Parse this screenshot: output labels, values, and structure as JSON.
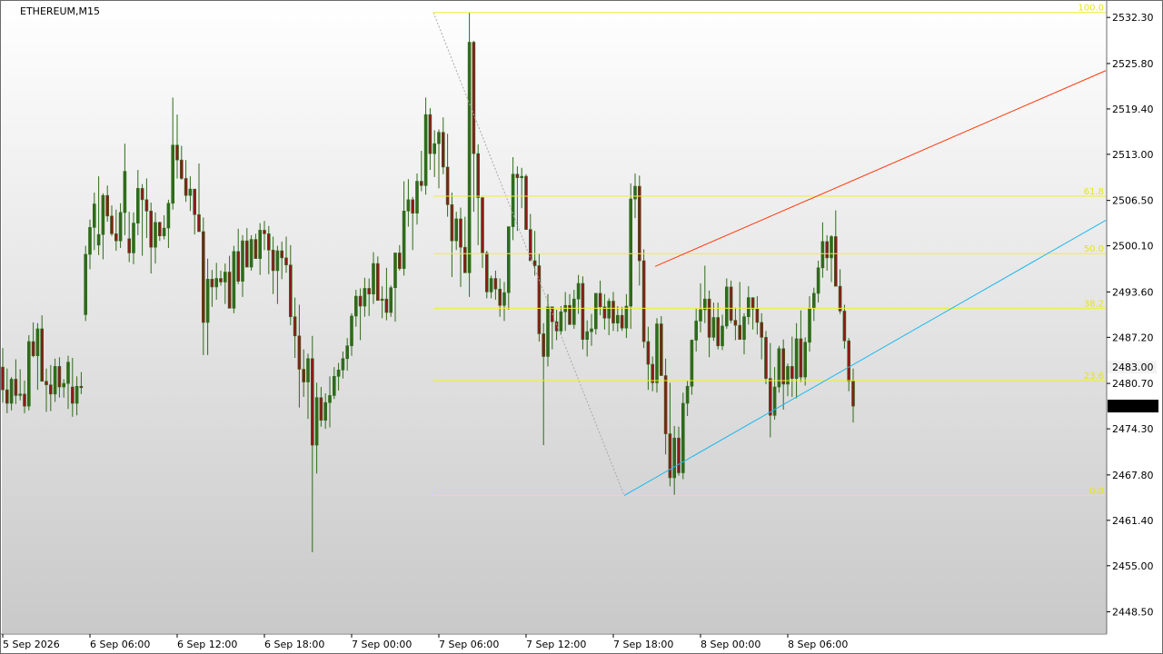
{
  "symbol_label": "ETHEREUM,M15",
  "colors": {
    "bull_candle": "#2f6b1a",
    "bear_candle": "#8b1a1a",
    "wick": "#2f6b1a",
    "fib_line": "#f2ee30",
    "fib_text": "#e9e21c",
    "upper_channel": "#ff3b10",
    "lower_channel": "#1cb8ee",
    "current_price_bg": "#000000",
    "ghost_price": "#bdbdbd"
  },
  "chart_data": {
    "type": "candlestick",
    "title": "ETHEREUM,M15",
    "y_axis": {
      "min": 2445.5,
      "max": 2534.5,
      "ticks": [
        2532.3,
        2525.8,
        2519.4,
        2513.0,
        2506.5,
        2500.1,
        2493.6,
        2487.2,
        2480.7,
        2474.3,
        2467.8,
        2461.4,
        2455.0,
        2448.5
      ],
      "tick_labels": [
        "2532.30",
        "2525.80",
        "2519.40",
        "2513.00",
        "2506.50",
        "2500.10",
        "2493.60",
        "2487.20",
        "2480.70",
        "2474.30",
        "2467.80",
        "2461.40",
        "2455.00",
        "2448.50"
      ]
    },
    "x_axis": {
      "labels": [
        "5 Sep 2026",
        "6 Sep 06:00",
        "6 Sep 12:00",
        "6 Sep 18:00",
        "7 Sep 00:00",
        "7 Sep 06:00",
        "7 Sep 12:00",
        "7 Sep 18:00",
        "8 Sep 00:00",
        "8 Sep 06:00"
      ]
    },
    "current_price": {
      "value": 2477.51,
      "label": "2477.51"
    },
    "ghost_price": {
      "value": 2483.0,
      "label": "2483.00"
    },
    "fibonacci_retracement": {
      "high": 2533.0,
      "low": 2464.9,
      "levels": [
        {
          "label": "100.0",
          "value": 2533.0
        },
        {
          "label": "61.8",
          "value": 2507.1
        },
        {
          "label": "50.0",
          "value": 2499.0
        },
        {
          "label": "38.2",
          "value": 2491.3
        },
        {
          "label": "23.6",
          "value": 2481.1
        },
        {
          "label": "0.0",
          "value": 2464.9
        }
      ]
    },
    "channel": {
      "upper": [
        [
          "7 Sep 18:15",
          2497.2
        ],
        [
          "8 Sep 12:30",
          2524.8
        ]
      ],
      "lower": [
        [
          "7 Sep 16:45",
          2464.9
        ],
        [
          "8 Sep 12:30",
          2503.7
        ]
      ]
    },
    "candles": [
      [
        2483.0,
        2485.7,
        2478.0,
        2479.8
      ],
      [
        2479.8,
        2482.8,
        2476.5,
        2477.9
      ],
      [
        2477.9,
        2481.6,
        2476.9,
        2481.3
      ],
      [
        2481.3,
        2484.1,
        2477.8,
        2479.0
      ],
      [
        2479.0,
        2482.7,
        2478.3,
        2479.2
      ],
      [
        2479.2,
        2481.1,
        2476.5,
        2477.5
      ],
      [
        2477.5,
        2487.5,
        2476.9,
        2486.6
      ],
      [
        2486.6,
        2489.3,
        2484.4,
        2484.6
      ],
      [
        2484.6,
        2489.2,
        2479.8,
        2488.4
      ],
      [
        2488.4,
        2490.3,
        2483.2,
        2481.0
      ],
      [
        2481.0,
        2482.8,
        2476.7,
        2480.5
      ],
      [
        2480.5,
        2483.3,
        2476.8,
        2479.2
      ],
      [
        2479.2,
        2484.2,
        2478.1,
        2483.1
      ],
      [
        2483.1,
        2484.4,
        2478.7,
        2480.2
      ],
      [
        2480.2,
        2481.3,
        2478.7,
        2480.7
      ],
      [
        2480.7,
        2484.6,
        2477.1,
        2483.7
      ],
      [
        2480.2,
        2484.3,
        2476.0,
        2477.9
      ],
      [
        2477.9,
        2481.7,
        2476.2,
        2480.3
      ],
      [
        2480.3,
        2482.3,
        2479.2,
        2480.1
      ],
      [
        2490.4,
        2500.1,
        2489.5,
        2498.9
      ],
      [
        2498.9,
        2503.8,
        2496.8,
        2502.7
      ],
      [
        2502.7,
        2507.6,
        2499.5,
        2506.0
      ],
      [
        2500.2,
        2509.9,
        2498.8,
        2501.7
      ],
      [
        2501.7,
        2507.5,
        2498.2,
        2507.2
      ],
      [
        2507.2,
        2508.6,
        2503.5,
        2504.3
      ],
      [
        2504.3,
        2505.8,
        2501.5,
        2501.8
      ],
      [
        2501.8,
        2505.2,
        2499.4,
        2500.8
      ],
      [
        2500.8,
        2506.1,
        2499.8,
        2504.8
      ],
      [
        2504.8,
        2514.5,
        2501.6,
        2510.6
      ],
      [
        2501.1,
        2504.9,
        2497.8,
        2499.1
      ],
      [
        2499.1,
        2504.8,
        2497.5,
        2503.3
      ],
      [
        2503.3,
        2510.8,
        2501.6,
        2508.2
      ],
      [
        2508.2,
        2508.8,
        2498.7,
        2506.6
      ],
      [
        2506.6,
        2509.6,
        2501.2,
        2505.0
      ],
      [
        2505.0,
        2506.2,
        2496.2,
        2499.9
      ],
      [
        2499.9,
        2504.8,
        2497.6,
        2503.4
      ],
      [
        2503.4,
        2503.5,
        2500.8,
        2501.5
      ],
      [
        2501.5,
        2504.4,
        2501.0,
        2502.6
      ],
      [
        2502.6,
        2506.6,
        2499.8,
        2506.1
      ],
      [
        2506.1,
        2521.0,
        2505.2,
        2514.3
      ],
      [
        2514.3,
        2518.6,
        2509.6,
        2512.2
      ],
      [
        2512.2,
        2514.2,
        2509.4,
        2509.6
      ],
      [
        2509.6,
        2512.2,
        2506.3,
        2507.2
      ],
      [
        2507.2,
        2509.9,
        2505.0,
        2508.1
      ],
      [
        2508.1,
        2508.1,
        2501.7,
        2504.5
      ],
      [
        2504.5,
        2511.7,
        2502.4,
        2502.1
      ],
      [
        2502.1,
        2504.1,
        2484.7,
        2489.3
      ],
      [
        2489.3,
        2498.3,
        2484.7,
        2495.4
      ],
      [
        2495.4,
        2496.7,
        2491.5,
        2494.3
      ],
      [
        2494.3,
        2497.7,
        2492.5,
        2495.5
      ],
      [
        2495.5,
        2496.6,
        2494.5,
        2495.0
      ],
      [
        2495.0,
        2497.6,
        2491.9,
        2496.4
      ],
      [
        2496.4,
        2498.7,
        2493.8,
        2491.3
      ],
      [
        2491.3,
        2500.1,
        2490.6,
        2499.3
      ],
      [
        2499.3,
        2502.5,
        2494.7,
        2495.1
      ],
      [
        2495.1,
        2501.6,
        2492.9,
        2500.8
      ],
      [
        2500.8,
        2502.6,
        2499.3,
        2497.1
      ],
      [
        2497.1,
        2501.6,
        2496.6,
        2501.0
      ],
      [
        2501.0,
        2501.8,
        2498.3,
        2498.3
      ],
      [
        2498.3,
        2503.3,
        2496.0,
        2502.3
      ],
      [
        2502.3,
        2503.6,
        2499.5,
        2501.8
      ],
      [
        2501.8,
        2502.9,
        2496.1,
        2499.5
      ],
      [
        2499.5,
        2501.4,
        2493.3,
        2496.6
      ],
      [
        2496.6,
        2500.1,
        2491.9,
        2499.4
      ],
      [
        2499.4,
        2500.7,
        2495.4,
        2498.4
      ],
      [
        2498.4,
        2501.4,
        2496.3,
        2497.4
      ],
      [
        2497.4,
        2500.2,
        2488.9,
        2490.1
      ],
      [
        2490.1,
        2492.8,
        2484.3,
        2487.4
      ],
      [
        2487.4,
        2491.8,
        2477.3,
        2482.7
      ],
      [
        2482.7,
        2485.5,
        2478.8,
        2480.9
      ],
      [
        2480.9,
        2484.9,
        2475.7,
        2484.2
      ],
      [
        2484.2,
        2487.4,
        2456.9,
        2472.0
      ],
      [
        2472.0,
        2480.8,
        2468.0,
        2478.7
      ],
      [
        2478.7,
        2480.2,
        2474.6,
        2475.5
      ],
      [
        2475.5,
        2479.3,
        2474.3,
        2478.0
      ],
      [
        2478.0,
        2481.7,
        2474.5,
        2479.0
      ],
      [
        2479.0,
        2483.0,
        2478.5,
        2481.7
      ],
      [
        2481.7,
        2483.6,
        2479.7,
        2482.6
      ],
      [
        2482.6,
        2485.2,
        2481.4,
        2484.2
      ],
      [
        2484.2,
        2487.1,
        2482.5,
        2486.0
      ],
      [
        2486.0,
        2490.6,
        2484.6,
        2490.2
      ],
      [
        2490.2,
        2493.9,
        2488.7,
        2493.0
      ],
      [
        2493.0,
        2494.1,
        2486.8,
        2491.6
      ],
      [
        2491.6,
        2495.6,
        2490.1,
        2494.1
      ],
      [
        2494.1,
        2495.5,
        2490.2,
        2493.3
      ],
      [
        2493.3,
        2499.2,
        2491.9,
        2497.6
      ],
      [
        2497.6,
        2498.6,
        2493.2,
        2492.4
      ],
      [
        2492.4,
        2494.4,
        2489.9,
        2492.6
      ],
      [
        2492.6,
        2497.0,
        2489.6,
        2490.7
      ],
      [
        2490.7,
        2494.5,
        2490.1,
        2494.2
      ],
      [
        2494.2,
        2498.2,
        2489.4,
        2499.1
      ],
      [
        2499.1,
        2500.2,
        2496.6,
        2496.9
      ],
      [
        2496.9,
        2509.2,
        2495.9,
        2505.0
      ],
      [
        2505.0,
        2509.5,
        2502.8,
        2506.6
      ],
      [
        2506.6,
        2507.0,
        2499.5,
        2504.7
      ],
      [
        2504.7,
        2510.3,
        2503.1,
        2509.2
      ],
      [
        2509.2,
        2513.5,
        2507.8,
        2508.6
      ],
      [
        2508.6,
        2521.0,
        2507.3,
        2518.6
      ],
      [
        2518.6,
        2519.5,
        2510.8,
        2513.1
      ],
      [
        2513.1,
        2516.4,
        2509.8,
        2514.5
      ],
      [
        2514.5,
        2516.5,
        2508.2,
        2516.1
      ],
      [
        2516.1,
        2518.2,
        2510.2,
        2511.2
      ],
      [
        2511.2,
        2515.9,
        2504.2,
        2505.9
      ],
      [
        2505.9,
        2507.6,
        2495.7,
        2500.8
      ],
      [
        2500.8,
        2504.9,
        2499.5,
        2503.9
      ],
      [
        2503.9,
        2505.5,
        2494.3,
        2499.9
      ],
      [
        2499.9,
        2504.2,
        2496.6,
        2496.3
      ],
      [
        2496.3,
        2533.0,
        2492.9,
        2528.8
      ],
      [
        2528.8,
        2529.0,
        2504.9,
        2513.1
      ],
      [
        2513.1,
        2514.4,
        2500.2,
        2506.9
      ],
      [
        2506.9,
        2506.8,
        2497.0,
        2499.1
      ],
      [
        2499.1,
        2499.4,
        2492.7,
        2493.6
      ],
      [
        2493.6,
        2495.9,
        2492.7,
        2495.5
      ],
      [
        2495.5,
        2496.6,
        2492.5,
        2494.0
      ],
      [
        2494.0,
        2495.5,
        2490.1,
        2491.7
      ],
      [
        2491.7,
        2495.0,
        2489.5,
        2493.5
      ],
      [
        2493.5,
        2502.2,
        2491.1,
        2502.8
      ],
      [
        2502.8,
        2512.6,
        2500.9,
        2510.2
      ],
      [
        2510.2,
        2511.3,
        2502.2,
        2509.7
      ],
      [
        2509.7,
        2511.1,
        2505.4,
        2509.9
      ],
      [
        2509.9,
        2510.2,
        2502.5,
        2502.4
      ],
      [
        2502.4,
        2504.6,
        2498.7,
        2498.0
      ],
      [
        2498.0,
        2502.2,
        2495.9,
        2497.3
      ],
      [
        2497.3,
        2499.0,
        2486.6,
        2487.7
      ],
      [
        2487.7,
        2489.2,
        2472.0,
        2484.5
      ],
      [
        2484.5,
        2493.3,
        2483.1,
        2491.5
      ],
      [
        2491.5,
        2491.4,
        2485.5,
        2489.4
      ],
      [
        2489.4,
        2491.1,
        2486.8,
        2488.1
      ],
      [
        2488.1,
        2491.6,
        2487.6,
        2490.8
      ],
      [
        2490.8,
        2493.6,
        2488.1,
        2491.7
      ],
      [
        2491.7,
        2493.3,
        2490.6,
        2489.0
      ],
      [
        2489.0,
        2493.9,
        2488.4,
        2492.6
      ],
      [
        2492.6,
        2496.0,
        2490.5,
        2494.8
      ],
      [
        2494.8,
        2495.8,
        2485.5,
        2486.9
      ],
      [
        2486.9,
        2489.6,
        2484.5,
        2488.0
      ],
      [
        2488.0,
        2490.5,
        2486.0,
        2488.4
      ],
      [
        2488.4,
        2493.4,
        2487.6,
        2493.4
      ],
      [
        2493.4,
        2495.2,
        2490.3,
        2491.5
      ],
      [
        2491.5,
        2493.3,
        2488.3,
        2489.9
      ],
      [
        2489.9,
        2492.7,
        2487.5,
        2492.3
      ],
      [
        2492.3,
        2493.6,
        2488.1,
        2489.2
      ],
      [
        2489.2,
        2491.6,
        2488.0,
        2490.3
      ],
      [
        2490.3,
        2491.5,
        2488.1,
        2488.5
      ],
      [
        2488.5,
        2493.3,
        2487.1,
        2491.6
      ],
      [
        2491.6,
        2508.9,
        2488.4,
        2506.7
      ],
      [
        2506.7,
        2510.3,
        2504.0,
        2508.5
      ],
      [
        2508.5,
        2510.0,
        2494.5,
        2498.0
      ],
      [
        2498.0,
        2499.6,
        2485.7,
        2486.6
      ],
      [
        2486.6,
        2488.7,
        2479.8,
        2483.4
      ],
      [
        2483.4,
        2484.5,
        2479.6,
        2480.8
      ],
      [
        2480.8,
        2489.9,
        2479.4,
        2489.1
      ],
      [
        2489.1,
        2490.2,
        2482.6,
        2481.8
      ],
      [
        2481.8,
        2484.2,
        2470.7,
        2473.6
      ],
      [
        2473.6,
        2480.8,
        2466.2,
        2467.4
      ],
      [
        2467.4,
        2474.7,
        2465.0,
        2473.0
      ],
      [
        2473.0,
        2474.6,
        2467.7,
        2468.1
      ],
      [
        2468.1,
        2479.4,
        2467.2,
        2477.9
      ],
      [
        2477.9,
        2481.1,
        2476.1,
        2480.3
      ],
      [
        2480.3,
        2486.9,
        2479.1,
        2486.8
      ],
      [
        2486.8,
        2491.2,
        2485.2,
        2489.5
      ],
      [
        2489.5,
        2494.8,
        2487.9,
        2491.1
      ],
      [
        2491.1,
        2497.3,
        2489.2,
        2492.6
      ],
      [
        2492.6,
        2493.8,
        2484.4,
        2487.2
      ],
      [
        2487.2,
        2492.1,
        2486.7,
        2490.0
      ],
      [
        2490.0,
        2492.1,
        2485.5,
        2486.0
      ],
      [
        2486.0,
        2490.4,
        2485.4,
        2488.8
      ],
      [
        2488.8,
        2495.5,
        2488.4,
        2494.3
      ],
      [
        2494.3,
        2495.2,
        2489.2,
        2489.6
      ],
      [
        2489.6,
        2491.4,
        2486.8,
        2488.9
      ],
      [
        2488.9,
        2495.0,
        2487.4,
        2486.9
      ],
      [
        2486.9,
        2490.6,
        2484.8,
        2490.1
      ],
      [
        2490.1,
        2494.4,
        2489.0,
        2492.8
      ],
      [
        2492.8,
        2492.4,
        2488.3,
        2491.2
      ],
      [
        2491.2,
        2493.0,
        2487.6,
        2489.3
      ],
      [
        2489.3,
        2490.6,
        2484.1,
        2487.2
      ],
      [
        2487.2,
        2488.1,
        2480.6,
        2481.4
      ],
      [
        2481.4,
        2486.4,
        2473.1,
        2476.2
      ],
      [
        2476.2,
        2483.0,
        2475.6,
        2480.2
      ],
      [
        2480.2,
        2486.0,
        2479.4,
        2485.6
      ],
      [
        2485.6,
        2486.9,
        2477.0,
        2480.6
      ],
      [
        2480.6,
        2483.5,
        2478.9,
        2483.1
      ],
      [
        2483.1,
        2487.3,
        2478.8,
        2481.4
      ],
      [
        2481.4,
        2489.2,
        2478.6,
        2487.0
      ],
      [
        2487.0,
        2491.0,
        2480.9,
        2481.6
      ],
      [
        2481.6,
        2487.2,
        2480.4,
        2486.5
      ],
      [
        2486.5,
        2493.0,
        2485.2,
        2491.3
      ],
      [
        2491.3,
        2494.2,
        2489.5,
        2493.4
      ],
      [
        2493.4,
        2498.0,
        2492.1,
        2497.0
      ],
      [
        2497.0,
        2503.4,
        2495.6,
        2500.7
      ],
      [
        2500.7,
        2501.6,
        2496.6,
        2498.4
      ],
      [
        2498.4,
        2501.6,
        2495.0,
        2501.4
      ],
      [
        2501.4,
        2505.1,
        2496.0,
        2494.4
      ],
      [
        2494.4,
        2496.8,
        2490.5,
        2490.9
      ],
      [
        2490.9,
        2491.8,
        2485.6,
        2486.7
      ],
      [
        2486.7,
        2487.1,
        2479.6,
        2481.0
      ],
      [
        2481.0,
        2482.8,
        2475.2,
        2477.5
      ]
    ]
  }
}
